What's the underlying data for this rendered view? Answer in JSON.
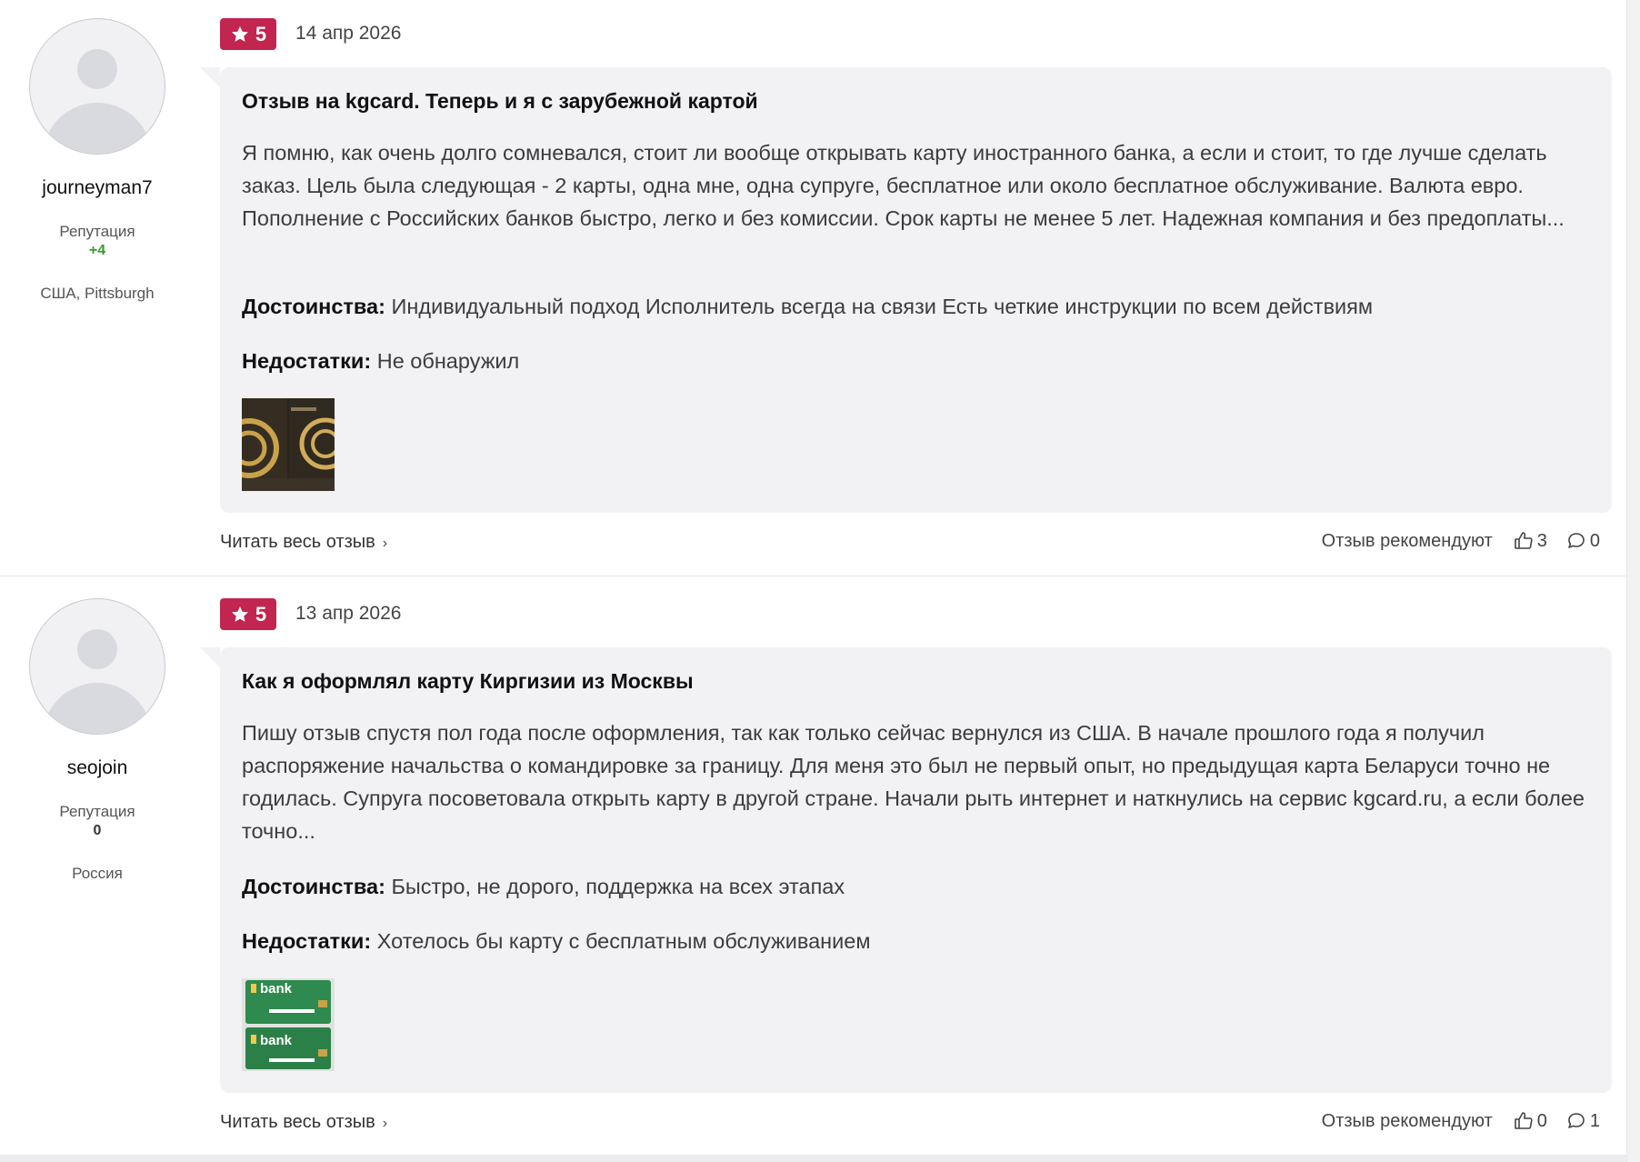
{
  "reviews": [
    {
      "user": {
        "name": "journeyman7",
        "reputation_label": "Репутация",
        "reputation_value": "+4",
        "location": "США, Pittsburgh"
      },
      "rating": "5",
      "date": "14 апр 2026",
      "title": "Отзыв на kgcard. Теперь и я с зарубежной картой",
      "text": "Я помню, как очень долго сомневался, стоит ли вообще открывать карту иностранного банка, а если и стоит, то где лучше сделать заказ. Цель была следующая - 2 карты, одна мне, одна супруге, бесплатное или около бесплатное обслуживание. Валюта евро. Пополнение с Российских банков быстро, легко и без комиссии. Срок карты не менее 5 лет. Надежная компания и без предоплаты...",
      "pros_label": "Достоинства:",
      "pros": "Индивидуальный подход Исполнитель всегда на связи Есть четкие инструкции по всем действиям",
      "cons_label": "Недостатки:",
      "cons": "Не обнаружил",
      "read_more": "Читать весь отзыв",
      "recommend_label": "Отзыв рекомендуют",
      "likes": "3",
      "comments": "0"
    },
    {
      "user": {
        "name": "seojoin",
        "reputation_label": "Репутация",
        "reputation_value": "0",
        "location": "Россия"
      },
      "rating": "5",
      "date": "13 апр 2026",
      "title": "Как я оформлял карту Киргизии из Москвы",
      "text": "Пишу отзыв спустя пол года после оформления, так как только сейчас вернулся из США. В начале прошлого года я получил распоряжение начальства о командировке за границу. Для меня это был не первый опыт, но предыдущая карта Беларуси точно не годилась. Супруга посоветовала открыть карту в другой стране. Начали рыть интернет и наткнулись на сервис kgcard.ru, а если более точно...",
      "pros_label": "Достоинства:",
      "pros": "Быстро, не дорого, поддержка на всех этапах",
      "cons_label": "Недостатки:",
      "cons": "Хотелось бы карту с бесплатным обслуживанием",
      "image_text": "bank",
      "read_more": "Читать весь отзыв",
      "recommend_label": "Отзыв рекомендуют",
      "likes": "0",
      "comments": "1"
    }
  ],
  "colors": {
    "badge": "#c2254f",
    "bubble": "#f2f2f5",
    "reputation_positive": "#3a9a2e"
  },
  "icons": [
    "avatar-placeholder-icon",
    "star-icon",
    "chevron-right-icon",
    "thumbs-up-icon",
    "comment-icon"
  ]
}
